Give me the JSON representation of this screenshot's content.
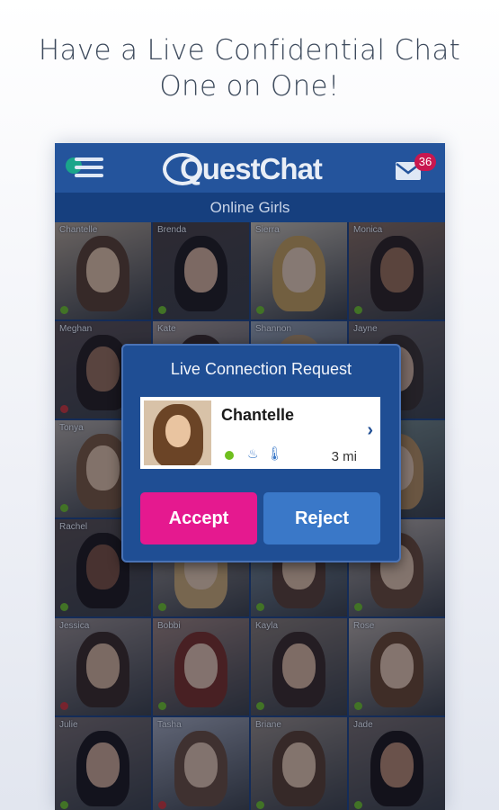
{
  "headline": {
    "line1": "Have a Live Confidential Chat",
    "line2": "One on One!"
  },
  "header": {
    "menu_icon": "hamburger-icon",
    "logo": "QuestChat",
    "mail_icon": "mail-icon",
    "unread_count": "36",
    "section_title": "Online Girls"
  },
  "colors": {
    "header_bg": "#24549c",
    "accept": "#e5198f",
    "reject": "#3a78c8",
    "online": "#6fbf1e",
    "offline": "#d0312d"
  },
  "profiles": [
    {
      "name": "Chantelle",
      "status": "online"
    },
    {
      "name": "Brenda",
      "status": "online"
    },
    {
      "name": "Sierra",
      "status": "online"
    },
    {
      "name": "Monica",
      "status": "online"
    },
    {
      "name": "Meghan",
      "status": "offline"
    },
    {
      "name": "Kate",
      "status": "online"
    },
    {
      "name": "Shannon",
      "status": "online"
    },
    {
      "name": "Jayne",
      "status": "online"
    },
    {
      "name": "Tonya",
      "status": "online"
    },
    {
      "name": "",
      "status": "online"
    },
    {
      "name": "",
      "status": "online"
    },
    {
      "name": "",
      "status": "online"
    },
    {
      "name": "Rachel",
      "status": "online"
    },
    {
      "name": "",
      "status": "online"
    },
    {
      "name": "",
      "status": "online"
    },
    {
      "name": "",
      "status": "online"
    },
    {
      "name": "Jessica",
      "status": "offline"
    },
    {
      "name": "Bobbi",
      "status": "online"
    },
    {
      "name": "Kayla",
      "status": "online"
    },
    {
      "name": "Rose",
      "status": "online"
    },
    {
      "name": "Julie",
      "status": "online"
    },
    {
      "name": "Tasha",
      "status": "offline"
    },
    {
      "name": "Briane",
      "status": "online"
    },
    {
      "name": "Jade",
      "status": "online"
    }
  ],
  "modal": {
    "title": "Live Connection Request",
    "requester_name": "Chantelle",
    "online_icon": "online-dot-icon",
    "icon_a": "flame-icon",
    "icon_b": "thermometer-icon",
    "distance": "3 mi",
    "accept_label": "Accept",
    "reject_label": "Reject"
  }
}
